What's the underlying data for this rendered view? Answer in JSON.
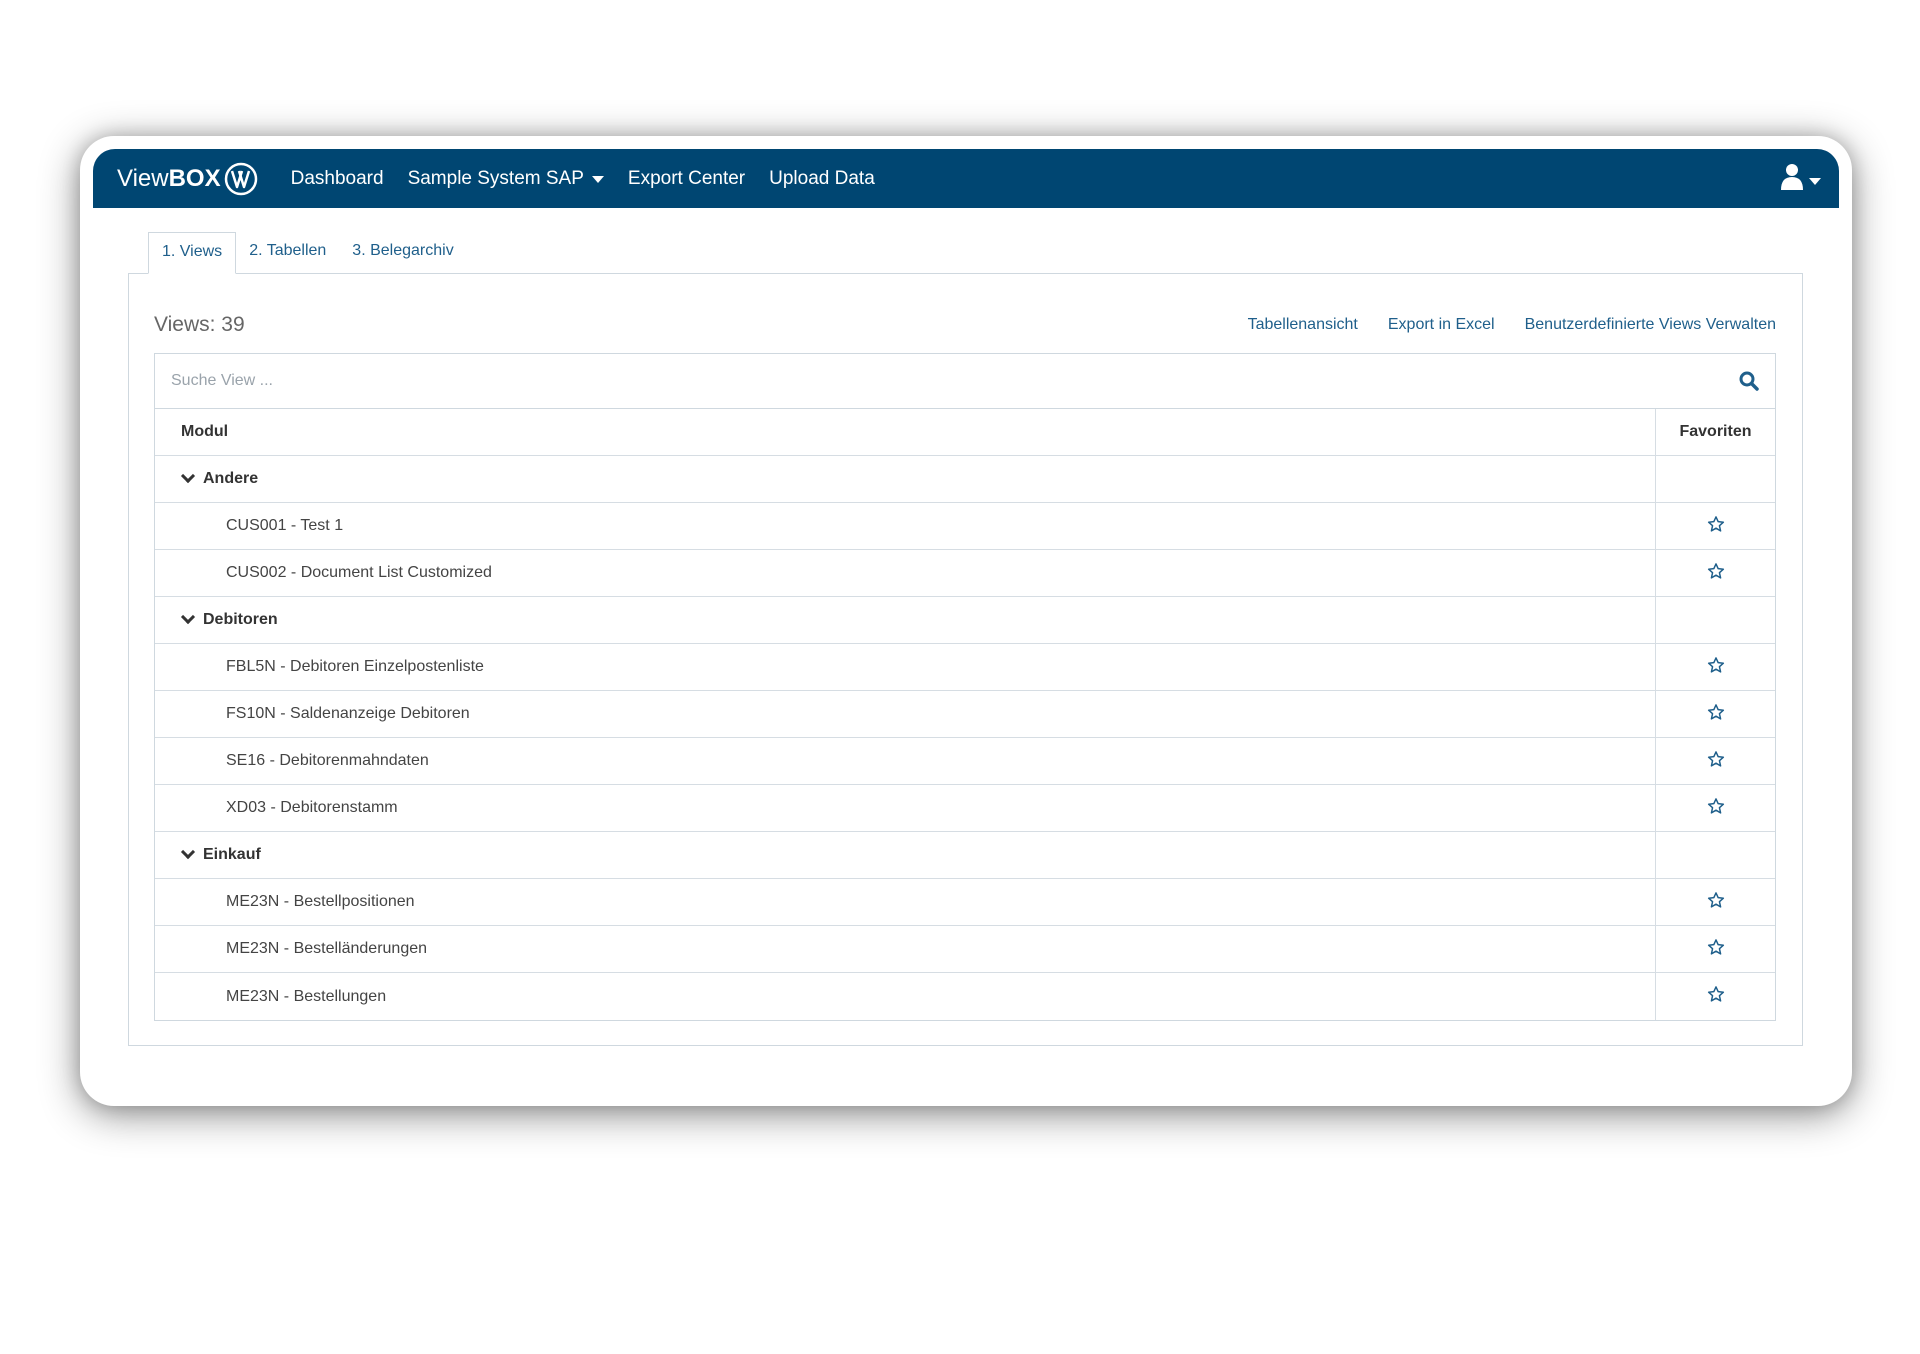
{
  "navbar": {
    "brand_light": "View",
    "brand_bold": "BOX",
    "items": [
      {
        "label": "Dashboard"
      },
      {
        "label": "Sample System SAP"
      },
      {
        "label": "Export Center"
      },
      {
        "label": "Upload Data"
      }
    ]
  },
  "tabs": [
    {
      "label": "1. Views"
    },
    {
      "label": "2. Tabellen"
    },
    {
      "label": "3. Belegarchiv"
    }
  ],
  "header": {
    "views_count": "Views: 39",
    "links": [
      "Tabellenansicht",
      "Export in Excel",
      "Benutzerdefinierte Views Verwalten"
    ]
  },
  "search": {
    "placeholder": "Suche View ..."
  },
  "table": {
    "col_modul": "Modul",
    "col_favoriten": "Favoriten",
    "groups": [
      {
        "name": "Andere",
        "items": [
          "CUS001 - Test 1",
          "CUS002 - Document List Customized"
        ]
      },
      {
        "name": "Debitoren",
        "items": [
          "FBL5N - Debitoren Einzelpostenliste",
          "FS10N - Saldenanzeige Debitoren",
          "SE16 - Debitorenmahndaten",
          "XD03 - Debitorenstamm"
        ]
      },
      {
        "name": "Einkauf",
        "items": [
          "ME23N - Bestellpositionen",
          "ME23N - Bestelländerungen",
          "ME23N - Bestellungen"
        ]
      }
    ]
  },
  "colors": {
    "navbar": "#004672",
    "link": "#1f5f8b",
    "star": "#1f5f8b"
  },
  "icons": {
    "search": "search-icon",
    "user": "user-icon",
    "favorite": "star-outline-icon",
    "expand": "chevron-down-icon"
  }
}
